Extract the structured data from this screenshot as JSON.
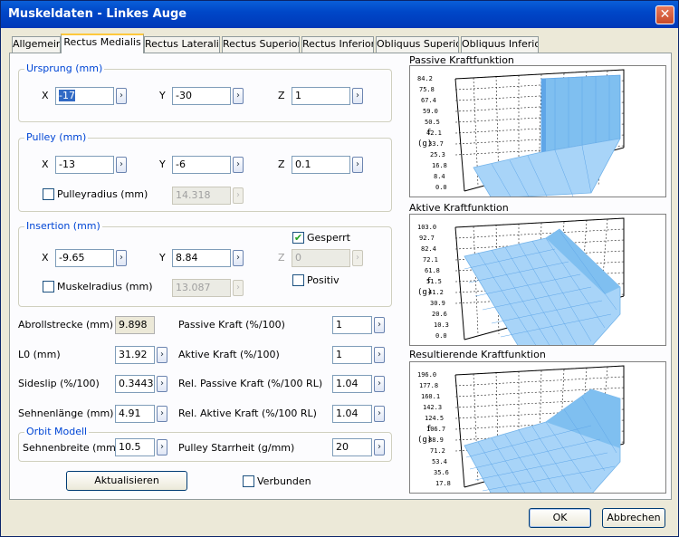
{
  "window": {
    "title": "Muskeldaten - Linkes Auge",
    "close_glyph": "✕"
  },
  "tabs": [
    {
      "label": "Allgemein",
      "active": false
    },
    {
      "label": "Rectus Medialis",
      "active": true
    },
    {
      "label": "Rectus Lateralis",
      "active": false
    },
    {
      "label": "Rectus Superior",
      "active": false
    },
    {
      "label": "Rectus Inferior",
      "active": false
    },
    {
      "label": "Obliquus Superior",
      "active": false
    },
    {
      "label": "Obliquus Inferior",
      "active": false
    }
  ],
  "arrow_glyph": "›",
  "ursprung": {
    "label": "Ursprung (mm)",
    "x_label": "X",
    "y_label": "Y",
    "z_label": "Z",
    "x": "-17",
    "y": "-30",
    "z": "1"
  },
  "pulley": {
    "label": "Pulley (mm)",
    "x_label": "X",
    "y_label": "Y",
    "z_label": "Z",
    "x": "-13",
    "y": "-6",
    "z": "0.1",
    "radius_label": "Pulleyradius (mm)",
    "radius_checked": false,
    "radius_value": "14.318"
  },
  "insertion": {
    "label": "Insertion (mm)",
    "x_label": "X",
    "y_label": "Y",
    "z_label": "Z",
    "x": "-9.65",
    "y": "8.84",
    "z": "0",
    "gesperrt_label": "Gesperrt",
    "gesperrt_checked": true,
    "positiv_label": "Positiv",
    "positiv_checked": false,
    "radius_label": "Muskelradius (mm)",
    "radius_checked": false,
    "radius_value": "13.087"
  },
  "params": {
    "abroll_label": "Abrollstrecke (mm)",
    "abroll_value": "9.898",
    "l0_label": "L0 (mm)",
    "l0_value": "31.92",
    "sideslip_label": "Sideslip (%/100)",
    "sideslip_value": "0.3443",
    "sehnenlaenge_label": "Sehnenlänge (mm)",
    "sehnenlaenge_value": "4.91",
    "passive_label": "Passive Kraft (%/100)",
    "passive_value": "1",
    "aktive_label": "Aktive Kraft (%/100)",
    "aktive_value": "1",
    "rel_passive_label": "Rel. Passive Kraft (%/100 RL)",
    "rel_passive_value": "1.04",
    "rel_aktive_label": "Rel. Aktive Kraft (%/100 RL)",
    "rel_aktive_value": "1.04"
  },
  "orbit": {
    "label": "Orbit Modell",
    "sehnenbreite_label": "Sehnenbreite (mm)",
    "sehnenbreite_value": "10.5",
    "pulley_starrheit_label": "Pulley Starrheit (g/mm)",
    "pulley_starrheit_value": "20"
  },
  "buttons": {
    "aktualisieren": "Aktualisieren",
    "verbunden_label": "Verbunden",
    "verbunden_checked": false,
    "ok": "OK",
    "abbrechen": "Abbrechen"
  },
  "plots": [
    {
      "title": "Passive Kraftfunktion",
      "axis_label_top": "f",
      "axis_label_bottom": "(g)",
      "ticks": [
        "84.2",
        "75.8",
        "67.4",
        "59.0",
        "50.5",
        "42.1",
        "33.7",
        "25.3",
        "16.8",
        "8.4",
        "0.0"
      ]
    },
    {
      "title": "Aktive Kraftfunktion",
      "axis_label_top": "f",
      "axis_label_bottom": "(g)",
      "ticks": [
        "103.0",
        "92.7",
        "82.4",
        "72.1",
        "61.8",
        "51.5",
        "41.2",
        "30.9",
        "20.6",
        "10.3",
        "0.0"
      ]
    },
    {
      "title": "Resultierende Kraftfunktion",
      "axis_label_top": "f",
      "axis_label_bottom": "(g)",
      "ticks": [
        "196.0",
        "177.8",
        "160.1",
        "142.3",
        "124.5",
        "106.7",
        "88.9",
        "71.2",
        "53.4",
        "35.6",
        "17.8"
      ]
    }
  ],
  "colors": {
    "titlebar": "#0047c8",
    "group_label": "#0046d5",
    "surface_light": "#a8d4f8",
    "surface_dark": "#5fa6e8"
  }
}
